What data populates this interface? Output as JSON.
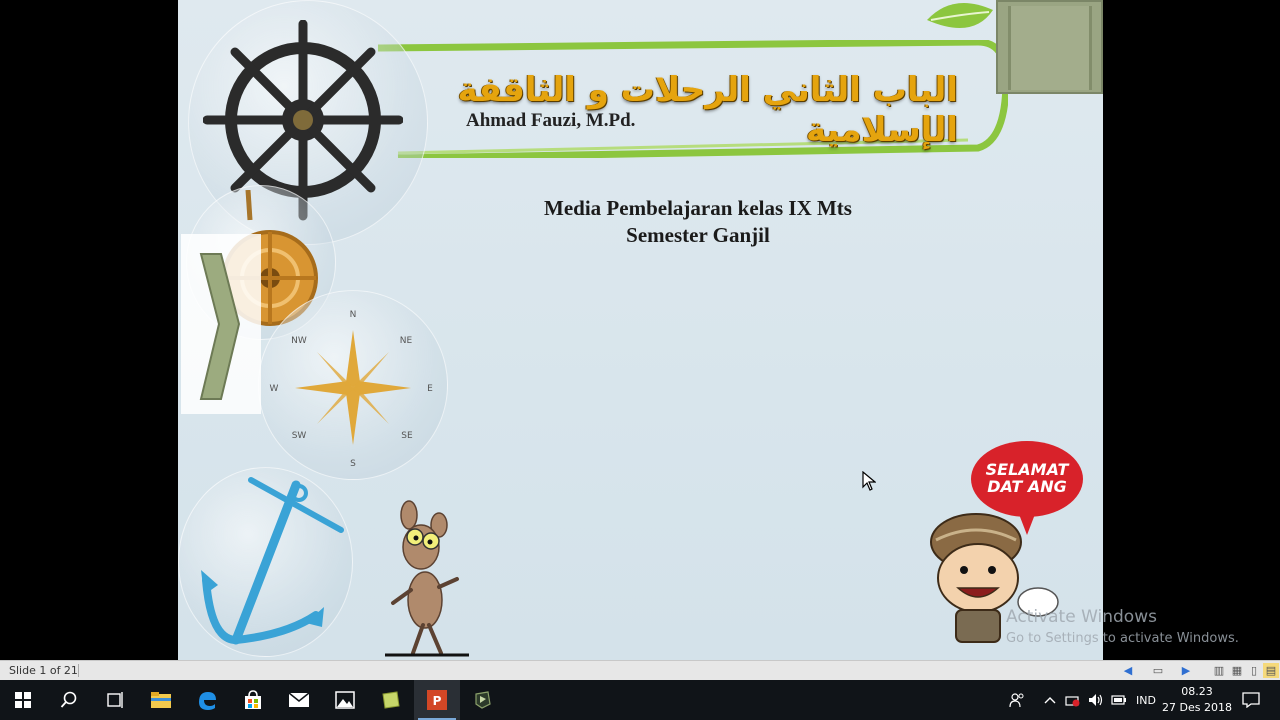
{
  "slide": {
    "arabic_title": "الباب الثاني الرحلات و الثاقفة الإسلامية",
    "author": "Ahmad Fauzi, M.Pd.",
    "subtitle_line1": "Media Pembelajaran kelas IX Mts",
    "subtitle_line2": "Semester Ganjil",
    "speech_line1": "SELAMAT",
    "speech_line2": "DAT ANG",
    "compass": {
      "n": "N",
      "s": "S",
      "e": "E",
      "w": "W",
      "ne": "NE",
      "nw": "NW",
      "se": "SE",
      "sw": "SW"
    }
  },
  "watermark": {
    "line1": "Activate Windows",
    "line2": "Go to Settings to activate Windows."
  },
  "statusbar": {
    "slide_count": "Slide 1 of 21"
  },
  "taskbar": {
    "language": "IND",
    "time": "08.23",
    "date": "27 Des 2018"
  },
  "colors": {
    "title_gold": "#e5a40e",
    "banner_green": "#8cc63f",
    "speech_red": "#d8222a",
    "anchor_blue": "#3aa3d6"
  }
}
